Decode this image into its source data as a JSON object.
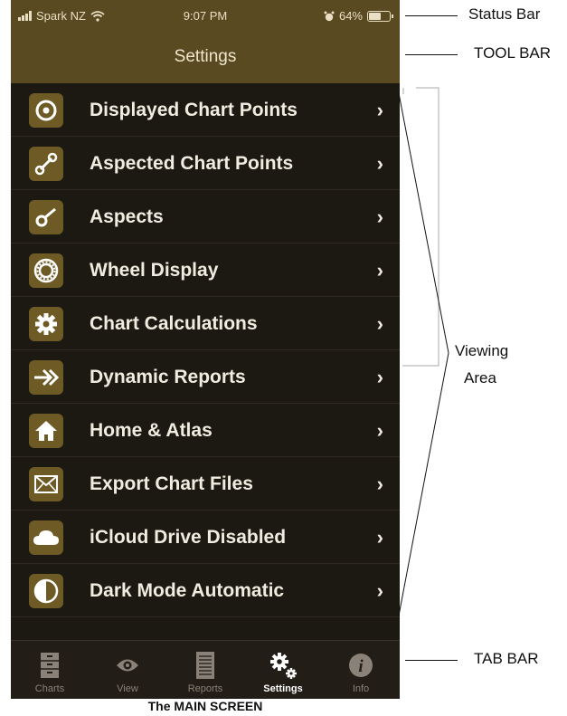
{
  "status_bar": {
    "carrier": "Spark NZ",
    "time": "9:07 PM",
    "battery_percent": "64%",
    "battery_level": 0.64
  },
  "tool_bar": {
    "title": "Settings"
  },
  "settings_items": [
    {
      "label": "Displayed Chart Points",
      "icon": "target-icon"
    },
    {
      "label": "Aspected Chart Points",
      "icon": "link-nodes-icon"
    },
    {
      "label": "Aspects",
      "icon": "aspect-icon"
    },
    {
      "label": "Wheel Display",
      "icon": "wheel-icon"
    },
    {
      "label": "Chart Calculations",
      "icon": "gear-icon"
    },
    {
      "label": "Dynamic Reports",
      "icon": "fast-forward-arrow-icon"
    },
    {
      "label": "Home & Atlas",
      "icon": "home-icon"
    },
    {
      "label": "Export Chart Files",
      "icon": "envelope-icon"
    },
    {
      "label": "iCloud Drive Disabled",
      "icon": "cloud-icon"
    },
    {
      "label": "Dark Mode Automatic",
      "icon": "half-circle-icon"
    }
  ],
  "tab_bar": {
    "tabs": [
      {
        "label": "Charts",
        "icon": "cabinet-icon",
        "active": false
      },
      {
        "label": "View",
        "icon": "eye-icon",
        "active": false
      },
      {
        "label": "Reports",
        "icon": "document-icon",
        "active": false
      },
      {
        "label": "Settings",
        "icon": "gears-icon",
        "active": true
      },
      {
        "label": "Info",
        "icon": "info-icon",
        "active": false
      }
    ]
  },
  "annotations": {
    "status_bar": "Status Bar",
    "tool_bar": "TOOL BAR",
    "viewing_area_line1": "Viewing",
    "viewing_area_line2": "Area",
    "tab_bar": "TAB BAR",
    "caption": "The MAIN SCREEN"
  },
  "colors": {
    "toolbar": "#5a4a22",
    "background": "#1c1812",
    "icon_tile": "#6e5a25",
    "text": "#f1ece0"
  }
}
